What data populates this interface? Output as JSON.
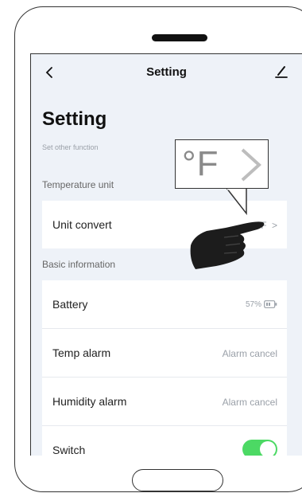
{
  "header": {
    "title": "Setting",
    "back_icon": "chevron-left-icon",
    "edit_icon": "edit-pen-icon"
  },
  "page": {
    "title": "Setting",
    "subtitle": "Set other function"
  },
  "sections": {
    "temperature_label": "Temperature unit",
    "basic_label": "Basic information"
  },
  "rows": {
    "unit_convert": {
      "label": "Unit convert",
      "value": "°F",
      "chevron": ">"
    },
    "battery": {
      "label": "Battery",
      "value": "57%"
    },
    "temp_alarm": {
      "label": "Temp alarm",
      "value": "Alarm cancel"
    },
    "humidity_alarm": {
      "label": "Humidity alarm",
      "value": "Alarm cancel"
    },
    "switch": {
      "label": "Switch",
      "state": "on"
    }
  },
  "callout": {
    "text": "°F"
  },
  "colors": {
    "accent_toggle": "#4cd964",
    "screen_bg": "#eef2f8",
    "muted_text": "#9aa0a8"
  }
}
